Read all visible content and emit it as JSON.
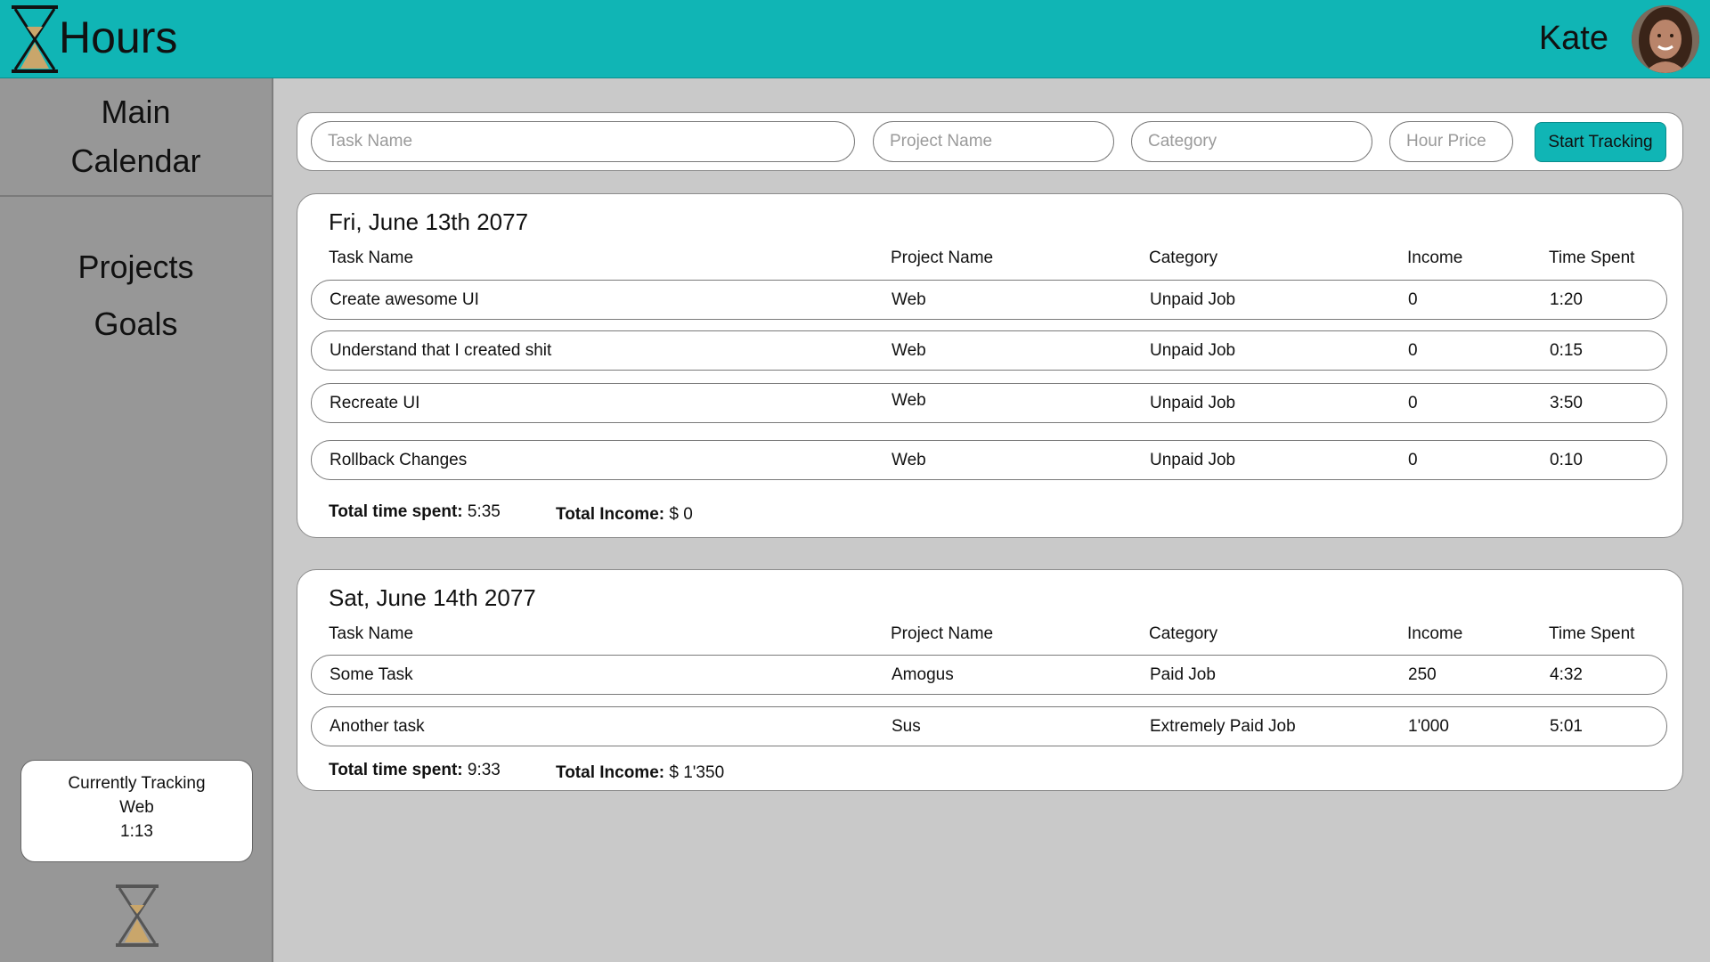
{
  "app": {
    "title": "Hours",
    "user": "Kate"
  },
  "nav": {
    "main": "Main",
    "calendar": "Calendar",
    "projects": "Projects",
    "goals": "Goals"
  },
  "tracking": {
    "label": "Currently Tracking",
    "project": "Web",
    "time": "1:13"
  },
  "tracker": {
    "task_placeholder": "Task Name",
    "project_placeholder": "Project Name",
    "category_placeholder": "Category",
    "price_placeholder": "Hour Price",
    "start_label": "Start Tracking"
  },
  "columns": [
    "Task Name",
    "Project Name",
    "Category",
    "Income",
    "Time Spent"
  ],
  "colors": {
    "accent": "#10b5b5",
    "sidebar": "#979797",
    "background": "#c9c9c9"
  },
  "days": [
    {
      "date": "Fri, June 13th 2077",
      "rows": [
        {
          "task": "Create awesome UI",
          "project": "Web",
          "category": "Unpaid Job",
          "income": "0",
          "time": "1:20"
        },
        {
          "task": "Understand that I created shit",
          "project": "Web",
          "category": "Unpaid Job",
          "income": "0",
          "time": "0:15"
        },
        {
          "task": "Recreate UI",
          "project": "Web",
          "category": "Unpaid Job",
          "income": "0",
          "time": "3:50"
        },
        {
          "task": "Rollback Changes",
          "project": "Web",
          "category": "Unpaid Job",
          "income": "0",
          "time": "0:10"
        }
      ],
      "total_time_label": "Total time spent:",
      "total_time": "5:35",
      "total_income_label": "Total Income:",
      "total_income": "$ 0"
    },
    {
      "date": "Sat, June 14th 2077",
      "rows": [
        {
          "task": "Some Task",
          "project": "Amogus",
          "category": "Paid Job",
          "income": "250",
          "time": "4:32"
        },
        {
          "task": "Another task",
          "project": "Sus",
          "category": "Extremely Paid Job",
          "income": "1'000",
          "time": "5:01"
        }
      ],
      "total_time_label": "Total time spent:",
      "total_time": "9:33",
      "total_income_label": "Total Income:",
      "total_income": "$ 1'350"
    }
  ]
}
